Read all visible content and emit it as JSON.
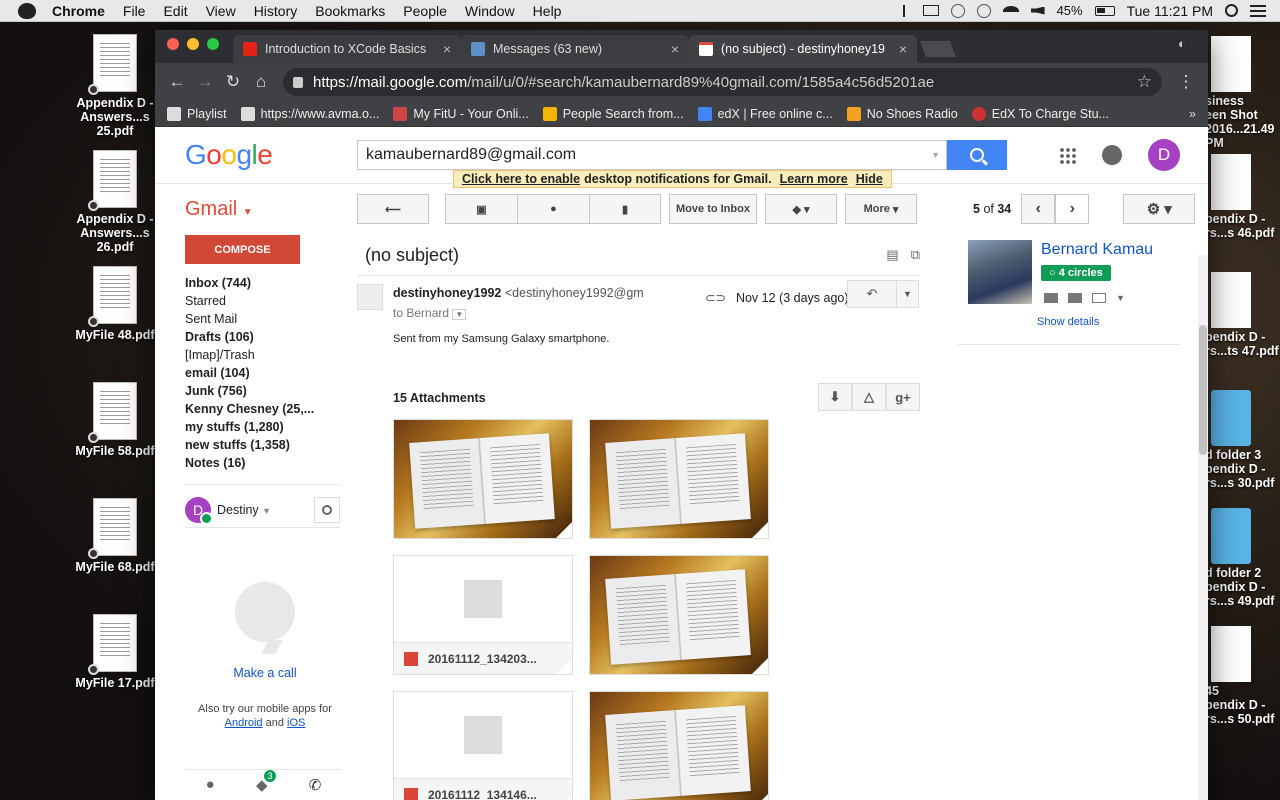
{
  "menubar": {
    "app": "Chrome",
    "items": [
      "File",
      "Edit",
      "View",
      "History",
      "Bookmarks",
      "People",
      "Window",
      "Help"
    ],
    "battery": "45%",
    "clock": "Tue 11:21 PM"
  },
  "desktop_left": [
    {
      "label1": "Appendix D -",
      "label2": "Answers...s 25.pdf"
    },
    {
      "label1": "Appendix D -",
      "label2": "Answers...s 26.pdf"
    },
    {
      "label1": "MyFile 48.pdf",
      "label2": ""
    },
    {
      "label1": "MyFile 58.pdf",
      "label2": ""
    },
    {
      "label1": "MyFile 68.pdf",
      "label2": ""
    },
    {
      "label1": "MyFile 17.pdf",
      "label2": ""
    }
  ],
  "desktop_right": [
    {
      "label1": "siness",
      "label2": "een Shot 2016...21.49 PM"
    },
    {
      "label1": "pendix D -",
      "label2": "rs...s 46.pdf"
    },
    {
      "label1": "pendix D -",
      "label2": "rs...ts 47.pdf"
    },
    {
      "label1": "d folder 3",
      "label2": "pendix D - rs...s 30.pdf"
    },
    {
      "label1": "d folder 2",
      "label2": "pendix D - rs...s 49.pdf"
    },
    {
      "label1": "45",
      "label2": "pendix D - rs...s 50.pdf"
    }
  ],
  "tabs": [
    {
      "title": "Introduction to XCode Basics",
      "color": "#e62117"
    },
    {
      "title": "Messages (63 new)",
      "color": "#5f8fc7"
    },
    {
      "title": "(no subject) - destinyhoney19",
      "color": "#dd4b39"
    }
  ],
  "address": {
    "origin": "https://mail.google.com",
    "path": "/mail/u/0/#search/kamaubernard89%40gmail.com/1585a4c56d5201ae"
  },
  "bookmarks": [
    {
      "label": "Playlist",
      "color": "#ddd"
    },
    {
      "label": "https://www.avma.o...",
      "color": "#ddd"
    },
    {
      "label": "My FitU - Your Onli...",
      "color": "#c44"
    },
    {
      "label": "People Search from...",
      "color": "#f4b400"
    },
    {
      "label": "edX | Free online c...",
      "color": "#4285f4"
    },
    {
      "label": "No Shoes Radio",
      "color": "#f4a020"
    },
    {
      "label": "EdX To Charge Stu...",
      "color": "#c33"
    }
  ],
  "gmail": {
    "search_value": "kamaubernard89@gmail.com",
    "avatar_letter": "D",
    "notif_link": "Click here to enable",
    "notif_text": "desktop notifications for Gmail.",
    "notif_learn": "Learn more",
    "notif_hide": "Hide",
    "app_label": "Gmail",
    "move_to_inbox": "Move to Inbox",
    "more": "More",
    "pager_current": "5",
    "pager_of": "of",
    "pager_total": "34",
    "compose": "COMPOSE",
    "labels": [
      {
        "text": "Inbox (744)",
        "bold": true
      },
      {
        "text": "Starred",
        "bold": false
      },
      {
        "text": "Sent Mail",
        "bold": false
      },
      {
        "text": "Drafts (106)",
        "bold": true
      },
      {
        "text": "[Imap]/Trash",
        "bold": false
      },
      {
        "text": "email (104)",
        "bold": true
      },
      {
        "text": "Junk (756)",
        "bold": true
      },
      {
        "text": "Kenny Chesney (25,...",
        "bold": true
      },
      {
        "text": "my stuffs (1,280)",
        "bold": true
      },
      {
        "text": "new stuffs (1,358)",
        "bold": true
      },
      {
        "text": "Notes (16)",
        "bold": true
      }
    ],
    "chat_name": "Destiny",
    "make_call": "Make a call",
    "apps_note": "Also try our mobile apps for",
    "android": "Android",
    "and": "and",
    "ios": "iOS",
    "chat_badge": "3",
    "subject": "(no subject)",
    "sender_name": "destinyhoney1992",
    "sender_email": "<destinyhoney1992@gm",
    "date": "Nov 12 (3 days ago)",
    "to": "to Bernard",
    "body": "Sent from my Samsung Galaxy smartphone.",
    "attachments_header": "15 Attachments",
    "attachments": [
      {
        "type": "photo",
        "name": ""
      },
      {
        "type": "photo",
        "name": ""
      },
      {
        "type": "generic",
        "name": "20161112_134203..."
      },
      {
        "type": "photo",
        "name": ""
      },
      {
        "type": "generic",
        "name": "20161112_134146..."
      },
      {
        "type": "photo",
        "name": ""
      }
    ],
    "contact_name": "Bernard Kamau",
    "contact_circles": "4 circles",
    "show_details": "Show details"
  }
}
